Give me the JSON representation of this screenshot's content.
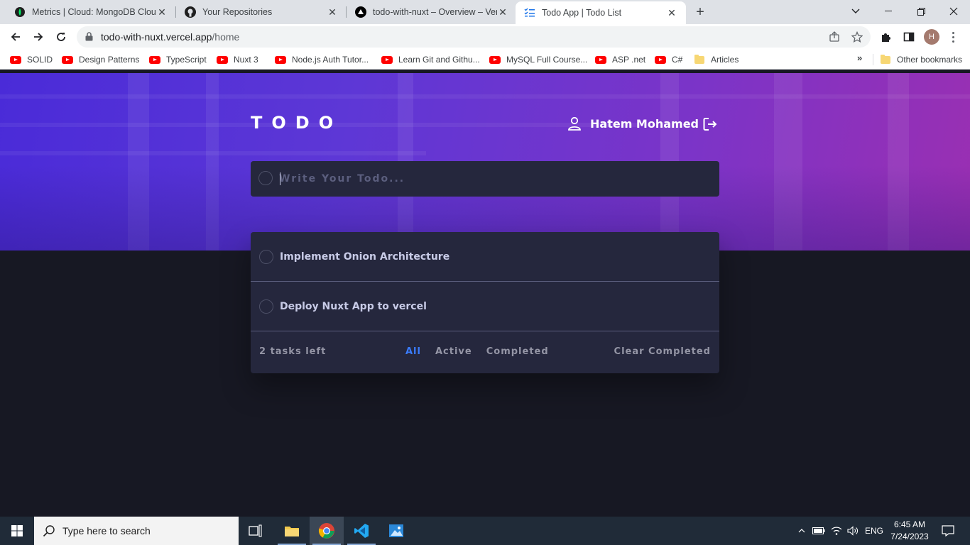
{
  "browser": {
    "tabs": [
      {
        "title": "Metrics | Cloud: MongoDB Cloud",
        "icon": "mongodb-leaf-icon",
        "active": false
      },
      {
        "title": "Your Repositories",
        "icon": "github-icon",
        "active": false
      },
      {
        "title": "todo-with-nuxt – Overview – Verc",
        "icon": "vercel-triangle-icon",
        "active": false
      },
      {
        "title": "Todo App | Todo List",
        "icon": "checklist-icon",
        "active": true
      }
    ],
    "url_host": "todo-with-nuxt.vercel.app",
    "url_path": "/home",
    "profile_initial": "H",
    "bookmarks": [
      {
        "label": "SOLID",
        "icon": "youtube-icon"
      },
      {
        "label": "Design Patterns",
        "icon": "youtube-icon"
      },
      {
        "label": "TypeScript",
        "icon": "youtube-icon"
      },
      {
        "label": "Nuxt 3",
        "icon": "youtube-icon"
      },
      {
        "label": "Node.js Auth Tutor...",
        "icon": "youtube-icon"
      },
      {
        "label": "Learn Git and Githu...",
        "icon": "youtube-icon"
      },
      {
        "label": "MySQL Full Course...",
        "icon": "youtube-icon"
      },
      {
        "label": "ASP .net",
        "icon": "youtube-icon"
      },
      {
        "label": "C#",
        "icon": "youtube-icon"
      },
      {
        "label": "Articles",
        "icon": "folder-icon"
      }
    ],
    "bookmarks_overflow": "»",
    "other_bookmarks": "Other bookmarks"
  },
  "app": {
    "brand": "TODO",
    "user_name": "Hatem Mohamed",
    "input_placeholder": "Write Your Todo...",
    "todos": [
      {
        "text": "Implement Onion Architecture",
        "completed": false
      },
      {
        "text": "Deploy Nuxt App to vercel",
        "completed": false
      }
    ],
    "footer": {
      "tasks_left": "2 tasks left",
      "filters": [
        "All",
        "Active",
        "Completed"
      ],
      "active_filter": "All",
      "clear": "Clear Completed"
    },
    "colors": {
      "accent": "#3a7cfd",
      "card": "#25273d",
      "page_bg": "#171823",
      "hero_start": "#4a2bd8",
      "hero_end": "#9a2fb2"
    }
  },
  "taskbar": {
    "search_placeholder": "Type here to search",
    "language": "ENG",
    "time": "6:45 AM",
    "date": "7/24/2023"
  }
}
